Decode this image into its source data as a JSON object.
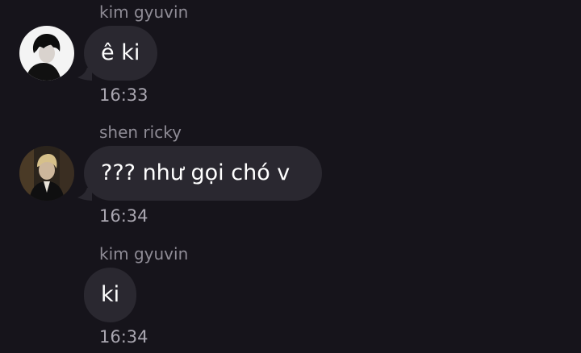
{
  "messages": [
    {
      "sender": "kim gyuvin",
      "text": "ê ki",
      "time": "16:33",
      "avatar": "avatar-gyuvin"
    },
    {
      "sender": "shen ricky",
      "text": "??? như gọi chó v",
      "time": "16:34",
      "avatar": "avatar-ricky"
    },
    {
      "sender": "kim gyuvin",
      "text": "ki",
      "time": "16:34",
      "avatar": null
    }
  ],
  "colors": {
    "background": "#16141b",
    "bubble": "#2a2830",
    "sender_text": "#8f8c96",
    "time_text": "#a9a6b0",
    "message_text": "#ffffff"
  }
}
